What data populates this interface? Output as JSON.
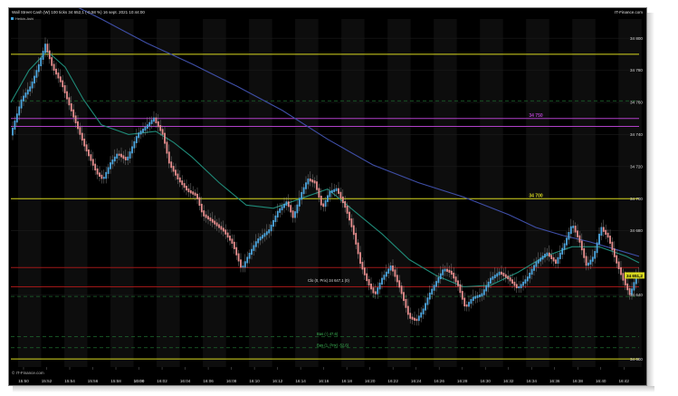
{
  "header": {
    "title": "Wall Street Cash (W) 100 ticks 34 652,1 (-0,58 %) 16 sept. 2021 10:44:00",
    "brand": "IT-Finance.com",
    "indicator": "Heikin-Ashi",
    "watermark": "© IT-Finance.com"
  },
  "chart_data": {
    "type": "candlestick",
    "x_ticks": [
      "15:50",
      "15:52",
      "15:54",
      "15:56",
      "15:58",
      "10:00",
      "16:02",
      "16:04",
      "16:06",
      "16:08",
      "16:10",
      "16:12",
      "16:14",
      "16:16",
      "16:18",
      "16:20",
      "16:22",
      "16:24",
      "16:26",
      "16:28",
      "16:30",
      "16:32",
      "16:34",
      "16:36",
      "16:38",
      "16:40",
      "16:42"
    ],
    "y_ticks": [
      34600,
      34640,
      34680,
      34700,
      34720,
      34740,
      34760,
      34780,
      34800
    ],
    "ylim": [
      34595,
      34812
    ],
    "levels": [
      {
        "value": 34790,
        "color": "#d8d820",
        "label": "",
        "style": "solid"
      },
      {
        "value": 34750,
        "color": "#b040c8",
        "label": "34 750",
        "style": "solid"
      },
      {
        "value": 34745,
        "color": "#b040c8",
        "label": "",
        "style": "solid"
      },
      {
        "value": 34700,
        "color": "#d8d820",
        "label": "34 700",
        "style": "solid"
      },
      {
        "value": 34657,
        "color": "#a01818",
        "label": "",
        "style": "solid"
      },
      {
        "value": 34645,
        "color": "#a01818",
        "label": "",
        "style": "solid"
      },
      {
        "value": 34600,
        "color": "#d8d820",
        "label": "",
        "style": "solid"
      },
      {
        "value": 34761,
        "color": "#1e6a2e",
        "label": "",
        "style": "dashed"
      },
      {
        "value": 34639,
        "color": "#1e6a2e",
        "label": "",
        "style": "dashed"
      },
      {
        "value": 34614,
        "color": "#1e6a2e",
        "label": "Bas (-) 47,6)",
        "style": "dashed"
      },
      {
        "value": 34607,
        "color": "#1e6a2e",
        "label": "Bas (1, Prix) -52,6)",
        "style": "dashed"
      }
    ],
    "annotations": [
      "Clo (0, Prix) 34 647,1 (0)"
    ],
    "price_tag": {
      "label": "34 651,2",
      "value": 34652.1,
      "color": "#d8d820"
    },
    "ma_slow": [
      [
        0,
        34836
      ],
      [
        50,
        34826
      ],
      [
        100,
        34812
      ],
      [
        150,
        34797
      ],
      [
        200,
        34784
      ],
      [
        250,
        34770
      ],
      [
        300,
        34755
      ],
      [
        350,
        34737
      ],
      [
        400,
        34721
      ],
      [
        450,
        34710
      ],
      [
        500,
        34701
      ],
      [
        550,
        34690
      ],
      [
        580,
        34682
      ],
      [
        610,
        34677
      ],
      [
        640,
        34673
      ],
      [
        670,
        34668
      ],
      [
        694,
        34664
      ]
    ],
    "ma_fast": [
      [
        0,
        34760
      ],
      [
        20,
        34780
      ],
      [
        40,
        34792
      ],
      [
        60,
        34782
      ],
      [
        80,
        34762
      ],
      [
        100,
        34746
      ],
      [
        130,
        34740
      ],
      [
        160,
        34742
      ],
      [
        180,
        34735
      ],
      [
        200,
        34726
      ],
      [
        230,
        34710
      ],
      [
        260,
        34696
      ],
      [
        290,
        34694
      ],
      [
        320,
        34700
      ],
      [
        350,
        34706
      ],
      [
        380,
        34692
      ],
      [
        410,
        34678
      ],
      [
        440,
        34662
      ],
      [
        470,
        34652
      ],
      [
        500,
        34645
      ],
      [
        530,
        34646
      ],
      [
        560,
        34654
      ],
      [
        590,
        34664
      ],
      [
        620,
        34670
      ],
      [
        650,
        34670
      ],
      [
        680,
        34664
      ],
      [
        694,
        34660
      ]
    ],
    "price_path": [
      [
        0,
        34740
      ],
      [
        12,
        34762
      ],
      [
        22,
        34770
      ],
      [
        32,
        34785
      ],
      [
        38,
        34796
      ],
      [
        46,
        34782
      ],
      [
        56,
        34772
      ],
      [
        70,
        34750
      ],
      [
        82,
        34732
      ],
      [
        95,
        34716
      ],
      [
        102,
        34712
      ],
      [
        110,
        34722
      ],
      [
        118,
        34728
      ],
      [
        128,
        34724
      ],
      [
        140,
        34740
      ],
      [
        148,
        34744
      ],
      [
        158,
        34750
      ],
      [
        168,
        34740
      ],
      [
        175,
        34722
      ],
      [
        185,
        34712
      ],
      [
        195,
        34705
      ],
      [
        205,
        34702
      ],
      [
        212,
        34690
      ],
      [
        222,
        34686
      ],
      [
        235,
        34680
      ],
      [
        245,
        34672
      ],
      [
        255,
        34656
      ],
      [
        262,
        34664
      ],
      [
        272,
        34674
      ],
      [
        285,
        34680
      ],
      [
        295,
        34692
      ],
      [
        305,
        34698
      ],
      [
        312,
        34688
      ],
      [
        320,
        34702
      ],
      [
        328,
        34712
      ],
      [
        336,
        34710
      ],
      [
        344,
        34694
      ],
      [
        352,
        34704
      ],
      [
        360,
        34706
      ],
      [
        370,
        34694
      ],
      [
        378,
        34680
      ],
      [
        386,
        34660
      ],
      [
        394,
        34648
      ],
      [
        402,
        34640
      ],
      [
        410,
        34650
      ],
      [
        420,
        34658
      ],
      [
        430,
        34644
      ],
      [
        440,
        34626
      ],
      [
        448,
        34624
      ],
      [
        455,
        34630
      ],
      [
        462,
        34640
      ],
      [
        470,
        34648
      ],
      [
        478,
        34656
      ],
      [
        486,
        34654
      ],
      [
        494,
        34646
      ],
      [
        502,
        34632
      ],
      [
        510,
        34638
      ],
      [
        520,
        34640
      ],
      [
        530,
        34650
      ],
      [
        540,
        34654
      ],
      [
        550,
        34650
      ],
      [
        560,
        34644
      ],
      [
        570,
        34650
      ],
      [
        580,
        34660
      ],
      [
        592,
        34666
      ],
      [
        602,
        34660
      ],
      [
        612,
        34672
      ],
      [
        620,
        34684
      ],
      [
        628,
        34674
      ],
      [
        636,
        34658
      ],
      [
        644,
        34664
      ],
      [
        652,
        34682
      ],
      [
        660,
        34676
      ],
      [
        668,
        34662
      ],
      [
        676,
        34650
      ],
      [
        684,
        34640
      ],
      [
        690,
        34650
      ],
      [
        694,
        34654
      ]
    ]
  }
}
